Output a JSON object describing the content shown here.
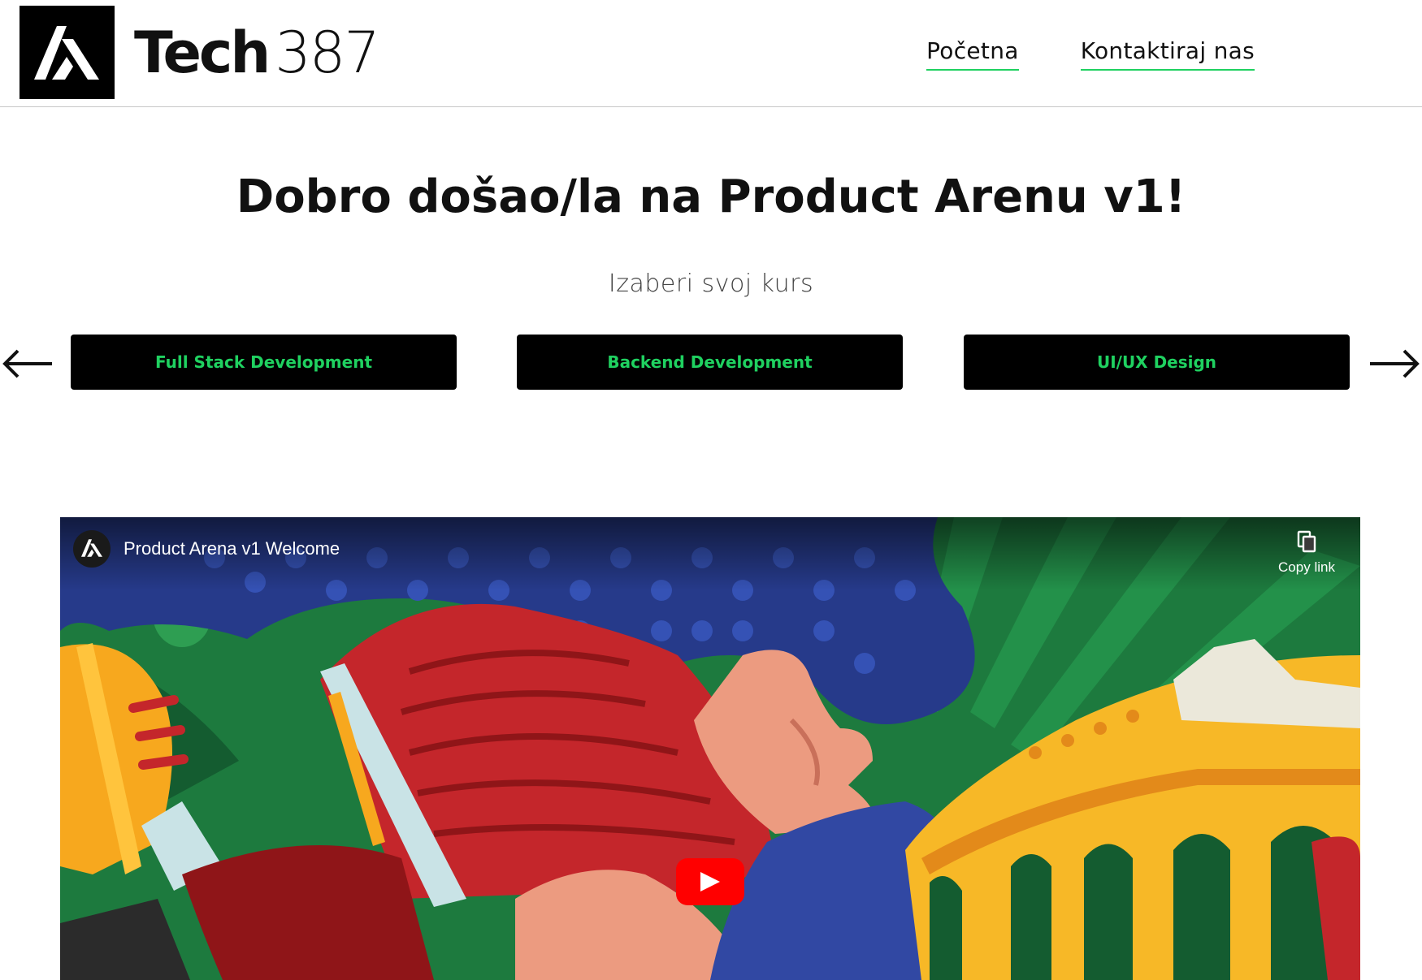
{
  "header": {
    "brand_bold": "Tech",
    "brand_light": "387",
    "nav": [
      {
        "label": "Početna"
      },
      {
        "label": "Kontaktiraj nas"
      }
    ],
    "accent_color": "#1fd160"
  },
  "hero": {
    "title": "Dobro došao/la na Product Arenu v1!",
    "subtitle": "Izaberi svoj kurs"
  },
  "courses": {
    "prev_icon": "arrow-left-icon",
    "next_icon": "arrow-right-icon",
    "items": [
      {
        "label": "Full Stack Development"
      },
      {
        "label": "Backend Development"
      },
      {
        "label": "UI/UX Design"
      }
    ]
  },
  "video": {
    "title": "Product Arena v1 Welcome",
    "copy_link_label": "Copy link",
    "play_icon": "play-icon",
    "play_color": "#ff0000"
  }
}
